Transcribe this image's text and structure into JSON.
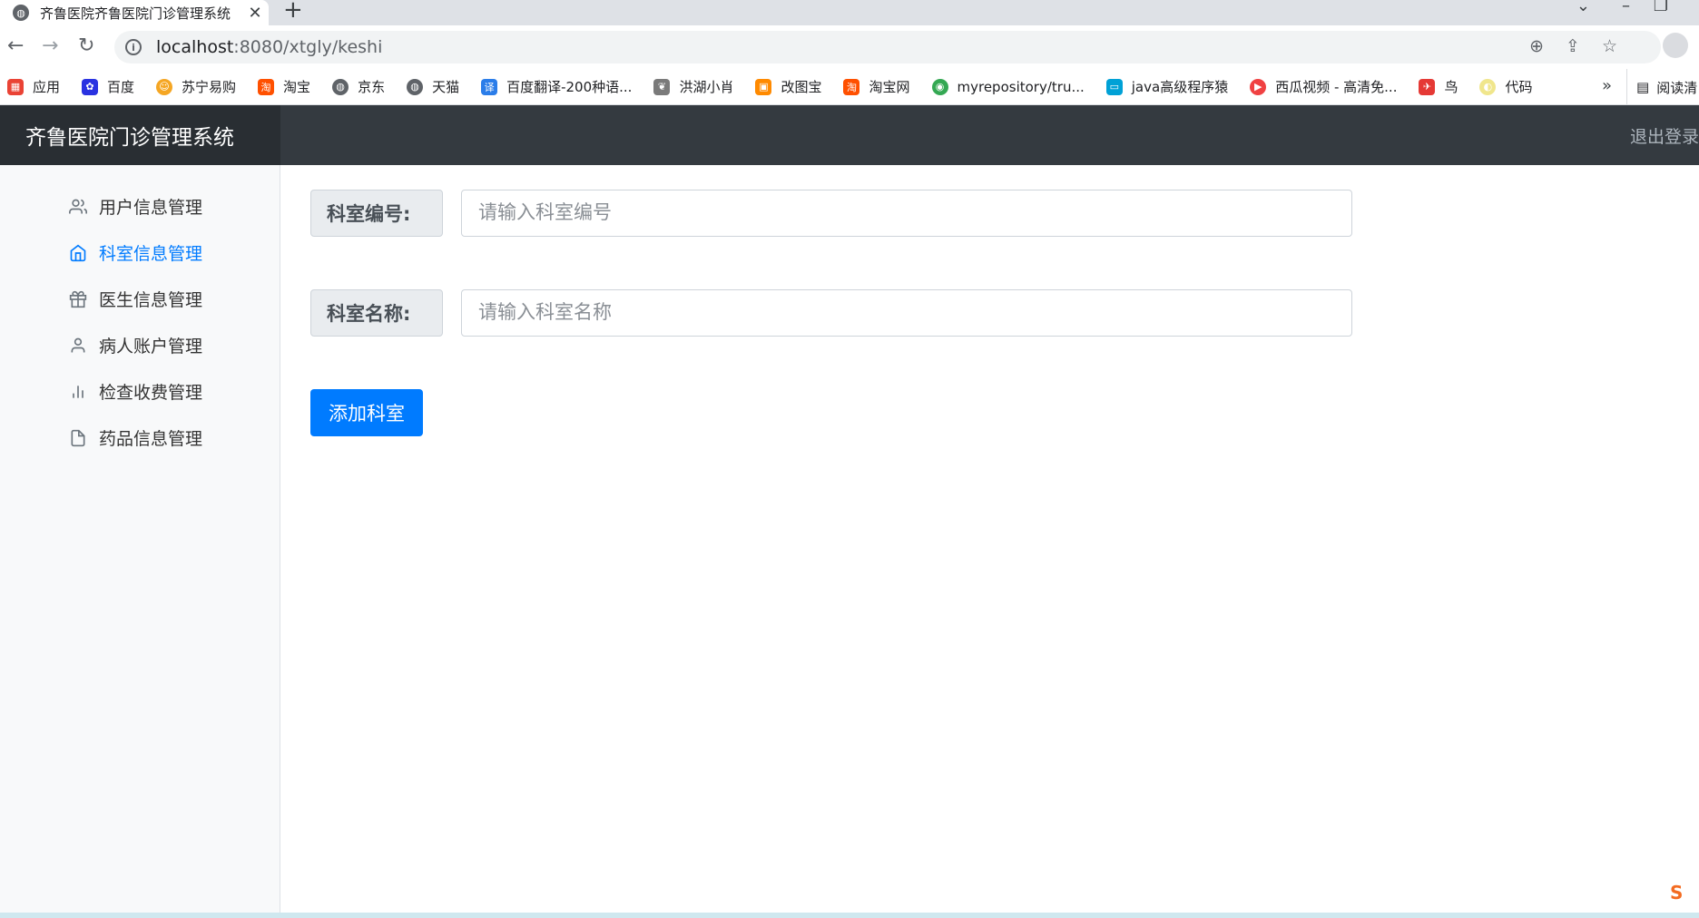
{
  "browser": {
    "tab_title": "齐鲁医院齐鲁医院门诊管理系统",
    "tab_close": "✕",
    "new_tab": "+",
    "url_host": "localhost",
    "url_path": ":8080/xtgly/keshi",
    "bookmarks": [
      "应用",
      "百度",
      "苏宁易购",
      "淘宝",
      "京东",
      "天猫",
      "百度翻译-200种语...",
      "洪湖小肖",
      "改图宝",
      "淘宝网",
      "myrepository/tru...",
      "java高级程序猿",
      "西瓜视频 - 高清免...",
      "鸟",
      "代码"
    ],
    "bookmarks_more": "»",
    "reading_list": "阅读清"
  },
  "header": {
    "brand": "齐鲁医院门诊管理系统",
    "logout": "退出登录"
  },
  "sidebar": {
    "items": [
      {
        "label": "用户信息管理",
        "icon": "users-icon"
      },
      {
        "label": "科室信息管理",
        "icon": "home-icon",
        "active": true
      },
      {
        "label": "医生信息管理",
        "icon": "gift-icon"
      },
      {
        "label": "病人账户管理",
        "icon": "user-icon"
      },
      {
        "label": "检查收费管理",
        "icon": "bar-chart-icon"
      },
      {
        "label": "药品信息管理",
        "icon": "file-icon"
      }
    ]
  },
  "form": {
    "dept_id_label": "科室编号:",
    "dept_id_placeholder": "请输入科室编号",
    "dept_name_label": "科室名称:",
    "dept_name_placeholder": "请输入科室名称",
    "submit_label": "添加科室"
  },
  "colors": {
    "header_bg": "#343a40",
    "brand_bg": "#292e33",
    "accent": "#007bff",
    "sidebar_bg": "#f8f9fa"
  }
}
